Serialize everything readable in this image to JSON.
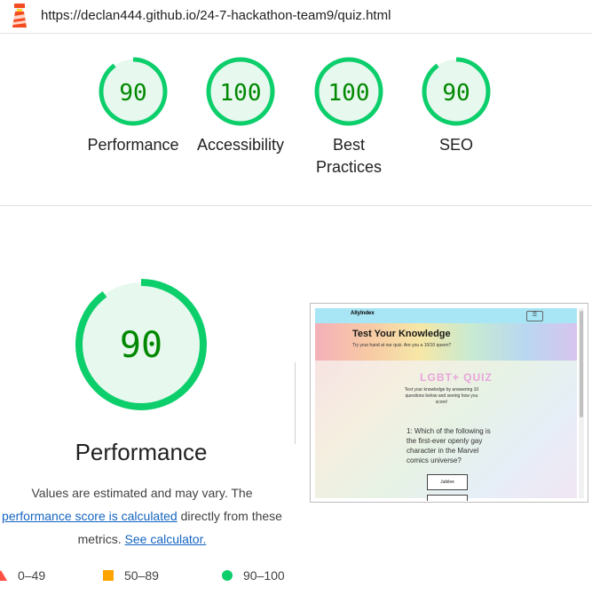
{
  "topbar": {
    "url": "https://declan444.github.io/24-7-hackathon-team9/quiz.html",
    "logo_icon": "lighthouse-icon"
  },
  "categories": [
    {
      "label": "Performance",
      "score": "90",
      "score_value": 90
    },
    {
      "label": "Accessibility",
      "score": "100",
      "score_value": 100
    },
    {
      "label": "Best Practices",
      "score": "100",
      "score_value": 100
    },
    {
      "label": "SEO",
      "score": "90",
      "score_value": 90
    }
  ],
  "colors": {
    "pass": "#0cce6b",
    "pass_fill": "#e7f8ee",
    "pass_text": "#008800",
    "average": "#ffa400",
    "fail": "#ff4e42",
    "link": "#1565c0"
  },
  "detail": {
    "score": "90",
    "score_value": 90,
    "title": "Performance",
    "desc_part1": "Values are estimated and may vary. The",
    "desc_link1": "performance score is calculated",
    "desc_part2": "directly from these metrics.",
    "desc_link2": "See calculator."
  },
  "legend": [
    {
      "range": "0–49",
      "shape": "triangle",
      "color": "#ff4e42"
    },
    {
      "range": "50–89",
      "shape": "square",
      "color": "#ffa400"
    },
    {
      "range": "90–100",
      "shape": "circle",
      "color": "#0cce6b"
    }
  ],
  "screenshot": {
    "brand": "AllyIndex",
    "menu_icon": "hamburger-icon",
    "hero_title": "Test Your Knowledge",
    "hero_subtitle": "Try your hand at our quiz. Are you a 10/10 queen?",
    "quiz_title": "LGBT+ QUIZ",
    "intro": "Test your knowledge by answering 10 questions below and seeing how you score!",
    "question": "1: Which of the following is the first-ever openly gay character in the Marvel comics universe?",
    "answer1": "Jubilee"
  }
}
